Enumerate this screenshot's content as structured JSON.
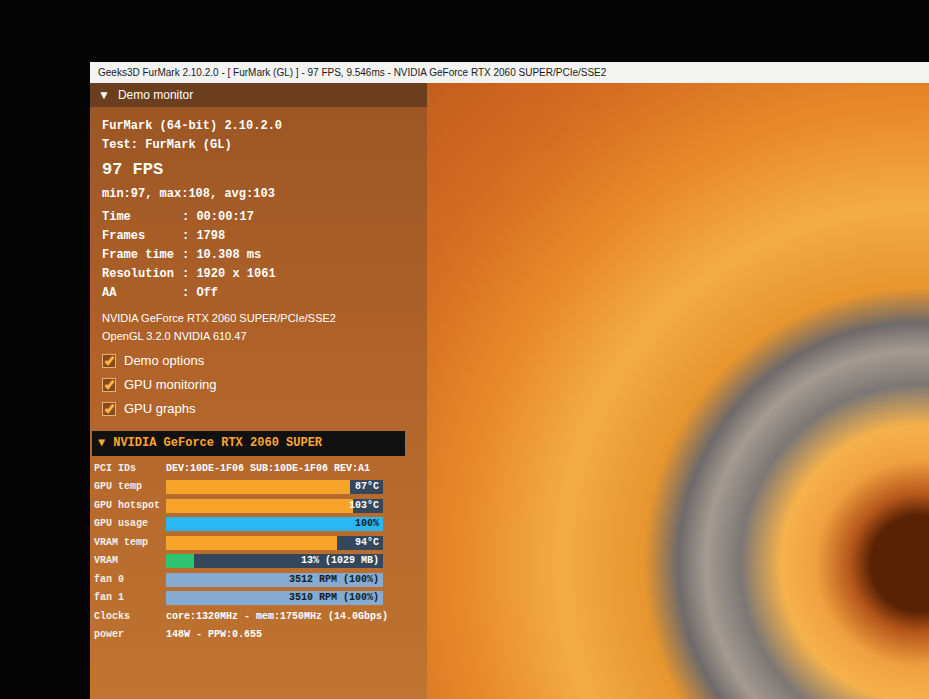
{
  "window": {
    "title": "Geeks3D FurMark 2.10.2.0 - [ FurMark (GL) ] - 97 FPS, 9.546ms - NVIDIA GeForce RTX 2060 SUPER/PCIe/SSE2"
  },
  "panel": {
    "header": {
      "arrow": "▼",
      "label": "Demo monitor"
    },
    "app": "FurMark (64-bit) 2.10.2.0",
    "test": "Test: FurMark (GL)",
    "fps": "97 FPS",
    "fps_stats": "min:97, max:108, avg:103",
    "stats": [
      {
        "label": "Time",
        "value": ": 00:00:17"
      },
      {
        "label": "Frames",
        "value": ": 1798"
      },
      {
        "label": "Frame time",
        "value": ": 10.308 ms"
      },
      {
        "label": "Resolution",
        "value": ": 1920 x 1061"
      },
      {
        "label": "AA",
        "value": ": Off"
      }
    ],
    "renderer": [
      "NVIDIA GeForce RTX 2060 SUPER/PCIe/SSE2",
      "OpenGL 3.2.0 NVIDIA 610.47"
    ],
    "options": [
      {
        "label": "Demo options",
        "checked": true
      },
      {
        "label": "GPU monitoring",
        "checked": true
      },
      {
        "label": "GPU graphs",
        "checked": true
      }
    ]
  },
  "gpu": {
    "arrow": "▼",
    "name": "NVIDIA GeForce RTX 2060 SUPER",
    "pci": {
      "label": "PCI IDs",
      "value": "DEV:10DE-1F06 SUB:10DE-1F06 REV:A1"
    },
    "meters": [
      {
        "label": "GPU temp",
        "level": 0.85,
        "reading": "87°C",
        "color": "#f7a52a"
      },
      {
        "label": "GPU hotspot",
        "level": 0.86,
        "reading": "103°C",
        "color": "#f7a52a"
      },
      {
        "label": "GPU usage",
        "level": 1.0,
        "reading": "100%",
        "color": "#2bb8f2"
      },
      {
        "label": "VRAM temp",
        "level": 0.79,
        "reading": "94°C",
        "color": "#f7a52a"
      },
      {
        "label": "VRAM",
        "level": 0.13,
        "reading": "13% (1029 MB)",
        "color": "#2fc472"
      },
      {
        "label": "fan 0",
        "level": 1.0,
        "reading": "3512 RPM (100%)",
        "color": "#86aad0"
      },
      {
        "label": "fan 1",
        "level": 1.0,
        "reading": "3510 RPM (100%)",
        "color": "#86aad0"
      }
    ],
    "clocks": {
      "label": "Clocks",
      "value": "core:1320MHz - mem:1750MHz (14.0Gbps)"
    },
    "power": {
      "label": "power",
      "value": "148W - PPW:0.655"
    }
  }
}
